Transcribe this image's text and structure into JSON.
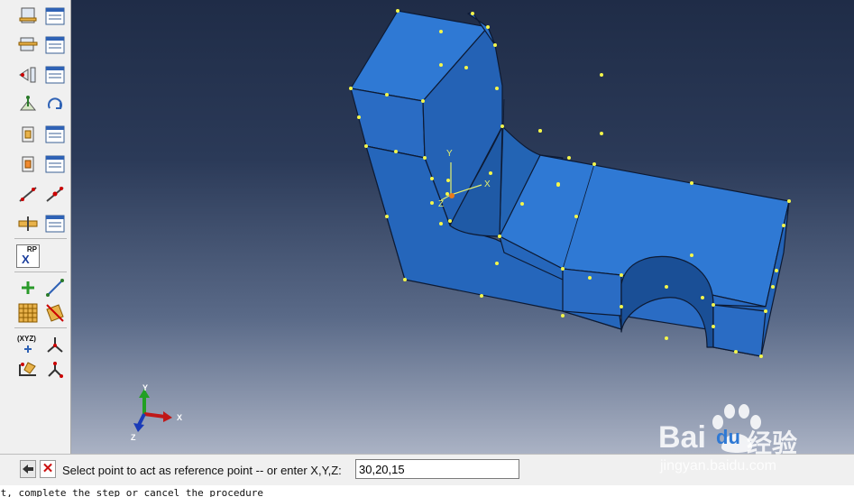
{
  "toolbar": {
    "tools": [
      "datum-plane-offset-icon",
      "table-icon",
      "datum-plane-3points-icon",
      "table-icon",
      "datum-axis-icon",
      "table-icon",
      "partition-face-icon",
      "rotate-icon",
      "partition-cell-extrude-icon",
      "table-icon",
      "partition-cell-sweep-icon",
      "table-icon",
      "create-edge-icon",
      "edge-split-icon",
      "datum-point-icon",
      "table-icon"
    ],
    "rp_button": {
      "top": "RP",
      "bottom": "X"
    },
    "lower_tools": [
      "create-point-icon",
      "create-line-icon",
      "mesh-grid-icon",
      "partition-face-sketch-icon",
      "datum-csys-icon",
      "datum-axis-principal-icon",
      "datum-midpoint-icon",
      "datum-offset-point-icon"
    ],
    "xyz_label": "(XYZ)"
  },
  "viewport": {
    "triad": {
      "x": "X",
      "y": "Y",
      "z": "Z"
    },
    "local_csys": {
      "x": "X",
      "y": "Y",
      "z": "Z"
    },
    "part_color": "#2f73c8",
    "background_top": "#1f2c47",
    "background_bottom": "#aab2c4"
  },
  "prompt": {
    "label": "Select point to act as reference point -- or enter X,Y,Z:",
    "value": "30,20,15"
  },
  "message": {
    "text": "ot, complete the step or cancel the procedure"
  },
  "watermark": {
    "brand": "Bai",
    "brand_end": "du",
    "cn": "经验",
    "url": "jingyan.baidu.com"
  }
}
